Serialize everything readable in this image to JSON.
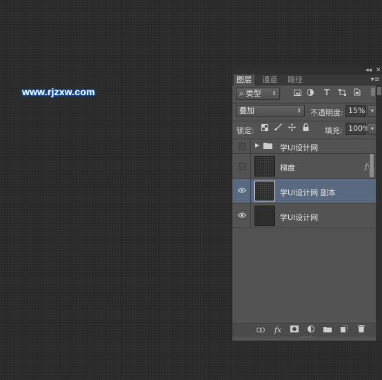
{
  "watermark": "www.rjzxw.com",
  "panel": {
    "collapse_label": "◂◂",
    "close_label": "✕",
    "tabs": [
      {
        "label": "图层",
        "active": true
      },
      {
        "label": "通道",
        "active": false
      },
      {
        "label": "路径",
        "active": false
      }
    ],
    "menu_label": "▾≡",
    "filter": {
      "search_glyph": "⌕",
      "kind_label": "类型",
      "caret": "⇕",
      "icons": [
        "image-filter-icon",
        "adjustment-filter-icon",
        "text-filter-icon",
        "shape-filter-icon",
        "smart-object-filter-icon"
      ]
    },
    "blend_mode": "叠加",
    "opacity_label": "不透明度:",
    "opacity_value": "15%",
    "lock_label": "锁定:",
    "fill_label": "填充:",
    "fill_value": "100%",
    "layers": [
      {
        "name": "学UI设计网",
        "kind": "group",
        "visible": false,
        "selected": false
      },
      {
        "name": "梯度",
        "kind": "layer",
        "visible": false,
        "selected": false,
        "fx": "fx"
      },
      {
        "name": "学UI设计网 副本",
        "kind": "layer",
        "visible": true,
        "selected": true
      },
      {
        "name": "学UI设计网",
        "kind": "layer",
        "visible": true,
        "selected": false
      }
    ],
    "bottom_icons": [
      "link-layers-icon",
      "add-style-icon",
      "add-mask-icon",
      "adjustment-layer-icon",
      "new-group-icon",
      "new-layer-icon",
      "delete-layer-icon"
    ],
    "glyphs": {
      "eye": "👁",
      "fx": "fx",
      "arrow_right": "▶",
      "dropdown": "▾"
    }
  },
  "colors": {
    "canvas": "#2b2b2b",
    "panel": "#535353",
    "selected_row": "#596a80",
    "watermark_glow": "#1b6fd8"
  }
}
